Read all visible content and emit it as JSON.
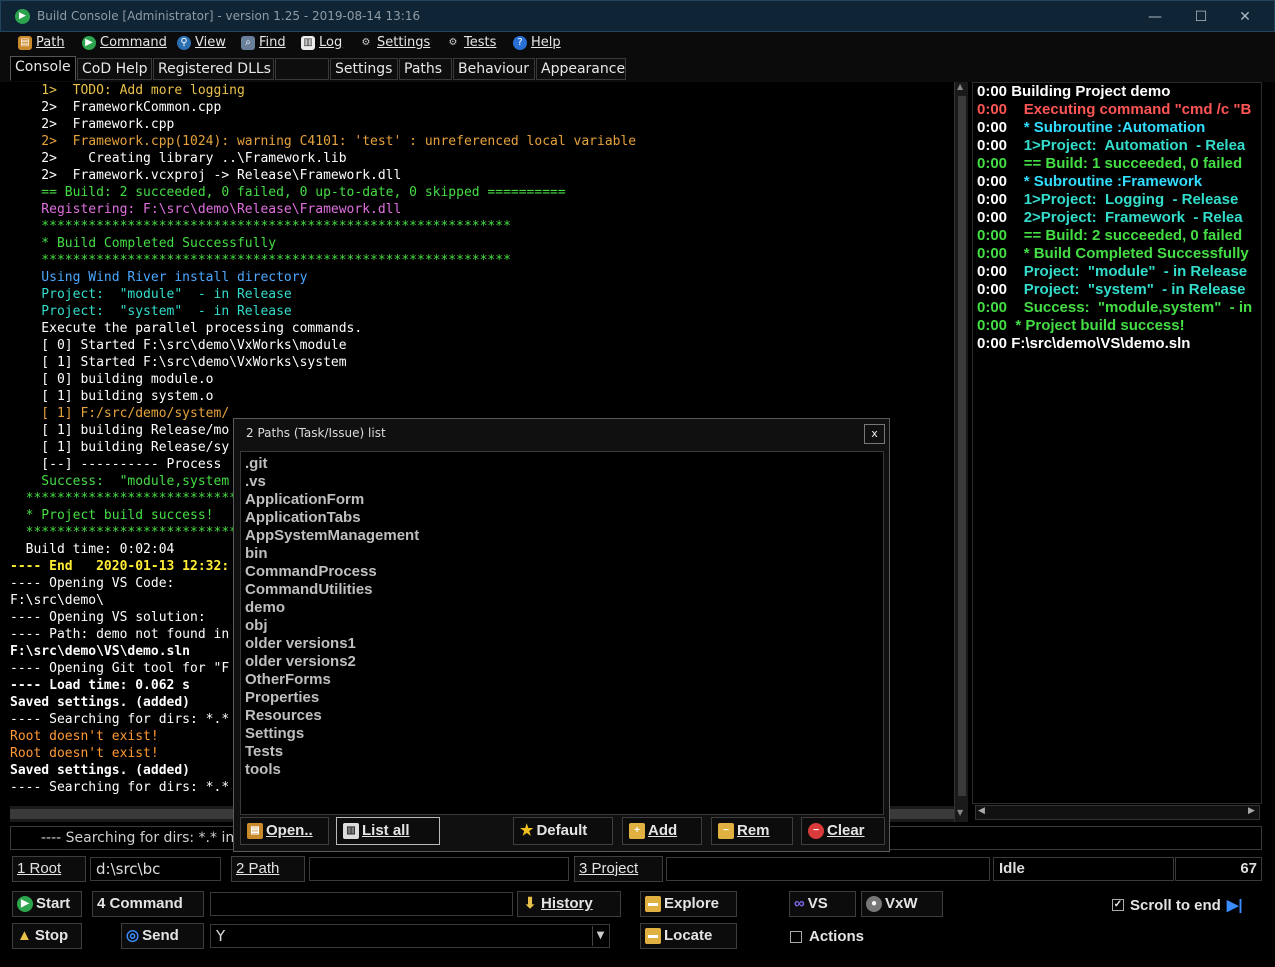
{
  "window": {
    "title": "Build Console [Administrator] - version 1.25 - 2019-08-14 13:16",
    "minimize": "—",
    "maximize": "☐",
    "close": "✕"
  },
  "menu": [
    "Path",
    "Command",
    "View",
    "Find",
    "Log",
    "Settings",
    "Tests",
    "Help"
  ],
  "tabs": [
    "Console",
    "CoD Help",
    "Registered DLLs",
    "",
    "Settings",
    "Paths",
    "Behaviour",
    "Appearance"
  ],
  "console_lines": [
    {
      "t": "    1>  TODO: Add more logging",
      "c": "#e8c14a"
    },
    {
      "t": "    2>  FrameworkCommon.cpp",
      "c": "#ffffff"
    },
    {
      "t": "    2>  Framework.cpp",
      "c": "#ffffff"
    },
    {
      "t": "    2>  Framework.cpp(1024): warning C4101: 'test' : unreferenced local variable",
      "c": "#e6a23c"
    },
    {
      "t": "    2>    Creating library ..\\Framework.lib",
      "c": "#ffffff"
    },
    {
      "t": "    2>  Framework.vcxproj -> Release\\Framework.dll",
      "c": "#ffffff"
    },
    {
      "t": "    == Build: 2 succeeded, 0 failed, 0 up-to-date, 0 skipped ==========",
      "c": "#44dd44"
    },
    {
      "t": "    Registering: F:\\src\\demo\\Release\\Framework.dll",
      "c": "#e070e0"
    },
    {
      "t": "    ************************************************************",
      "c": "#44dd44"
    },
    {
      "t": "    * Build Completed Successfully",
      "c": "#44dd44"
    },
    {
      "t": "    ************************************************************",
      "c": "#44dd44"
    },
    {
      "t": "    Using Wind River install directory",
      "c": "#4aa8ff"
    },
    {
      "t": "    Project:  \"module\"  - in Release",
      "c": "#33ddcc"
    },
    {
      "t": "    Project:  \"system\"  - in Release",
      "c": "#33ddcc"
    },
    {
      "t": "    Execute the parallel processing commands.",
      "c": "#ffffff"
    },
    {
      "t": "    [ 0] Started F:\\src\\demo\\VxWorks\\module",
      "c": "#ffffff"
    },
    {
      "t": "    [ 1] Started F:\\src\\demo\\VxWorks\\system",
      "c": "#ffffff"
    },
    {
      "t": "    [ 0] building module.o",
      "c": "#ffffff"
    },
    {
      "t": "    [ 1] building system.o",
      "c": "#ffffff"
    },
    {
      "t": "    [ 1] F:/src/demo/system/",
      "c": "#e6a23c"
    },
    {
      "t": "    [ 1] building Release/mo",
      "c": "#ffffff"
    },
    {
      "t": "    [ 1] building Release/sy",
      "c": "#ffffff"
    },
    {
      "t": "    [--] ---------- Process ",
      "c": "#ffffff"
    },
    {
      "t": "    Success:  \"module,system",
      "c": "#44dd44"
    },
    {
      "t": "  ******************************",
      "c": "#44dd44"
    },
    {
      "t": "  * Project build success!",
      "c": "#44dd44"
    },
    {
      "t": "  ******************************",
      "c": "#44dd44"
    },
    {
      "t": "  Build time: 0:02:04",
      "c": "#ffffff"
    },
    {
      "t": "---- End   2020-01-13 12:32:",
      "c": "#ffee33",
      "b": true
    },
    {
      "t": "---- Opening VS Code:",
      "c": "#ffffff"
    },
    {
      "t": "F:\\src\\demo\\",
      "c": "#ffffff"
    },
    {
      "t": "---- Opening VS solution:",
      "c": "#ffffff"
    },
    {
      "t": "---- Path: demo not found in",
      "c": "#ffffff"
    },
    {
      "t": "F:\\src\\demo\\VS\\demo.sln",
      "c": "#ffffff",
      "b": true
    },
    {
      "t": "---- Opening Git tool for \"F",
      "c": "#ffffff"
    },
    {
      "t": "---- Load time: 0.062 s",
      "c": "#ffffff",
      "b": true
    },
    {
      "t": "Saved settings. (added)",
      "c": "#ffffff",
      "b": true
    },
    {
      "t": "---- Searching for dirs: *.*",
      "c": "#ffffff"
    },
    {
      "t": "Root doesn't exist!",
      "c": "#ff9933"
    },
    {
      "t": "Root doesn't exist!",
      "c": "#ff9933"
    },
    {
      "t": "Saved settings. (added)",
      "c": "#ffffff",
      "b": true
    },
    {
      "t": "---- Searching for dirs: *.*",
      "c": "#ffffff"
    }
  ],
  "right_lines": [
    {
      "time": "0:00",
      "tc": "#ffffff",
      "t": " Building Project demo",
      "c": "#ffffff"
    },
    {
      "time": "0:00",
      "tc": "#ff5555",
      "t": "    Executing command \"cmd /c \"B",
      "c": "#ff5555"
    },
    {
      "time": "0:00",
      "tc": "#ffffff",
      "t": "    * Subroutine :Automation",
      "c": "#33ddff"
    },
    {
      "time": "0:00",
      "tc": "#ffffff",
      "t": "    1>Project:  Automation  - Relea",
      "c": "#33ddcc"
    },
    {
      "time": "0:00",
      "tc": "#44dd44",
      "t": "    == Build: 1 succeeded, 0 failed",
      "c": "#44dd44"
    },
    {
      "time": "0:00",
      "tc": "#ffffff",
      "t": "    * Subroutine :Framework",
      "c": "#33ddff"
    },
    {
      "time": "0:00",
      "tc": "#ffffff",
      "t": "    1>Project:  Logging  - Release",
      "c": "#33ddcc"
    },
    {
      "time": "0:00",
      "tc": "#ffffff",
      "t": "    2>Project:  Framework  - Relea",
      "c": "#33ddcc"
    },
    {
      "time": "0:00",
      "tc": "#44dd44",
      "t": "    == Build: 2 succeeded, 0 failed",
      "c": "#44dd44"
    },
    {
      "time": "0:00",
      "tc": "#44dd44",
      "t": "    * Build Completed Successfully",
      "c": "#44dd44"
    },
    {
      "time": "0:00",
      "tc": "#ffffff",
      "t": "    Project:  \"module\"  - in Release",
      "c": "#33ddcc"
    },
    {
      "time": "0:00",
      "tc": "#ffffff",
      "t": "    Project:  \"system\"  - in Release",
      "c": "#33ddcc"
    },
    {
      "time": "0:00",
      "tc": "#44dd44",
      "t": "    Success:  \"module,system\"  - in",
      "c": "#44dd44"
    },
    {
      "time": "0:00",
      "tc": "#44dd44",
      "t": "  * Project build success!",
      "c": "#44dd44"
    },
    {
      "time": "0:00",
      "tc": "#ffffff",
      "t": " F:\\src\\demo\\VS\\demo.sln",
      "c": "#ffffff"
    }
  ],
  "command_line": "---- Searching for dirs: *.* inside",
  "dialog": {
    "title": "2 Paths (Task/Issue) list",
    "close": "x",
    "items": [
      ".git",
      ".vs",
      "ApplicationForm",
      "ApplicationTabs",
      "AppSystemManagement",
      "bin",
      "CommandProcess",
      "CommandUtilities",
      "demo",
      "obj",
      "older versions1",
      "older versions2",
      "OtherForms",
      "Properties",
      "Resources",
      "Settings",
      "Tests",
      "tools"
    ],
    "buttons": {
      "open": "Open..",
      "list_all": "List all",
      "default": "Default",
      "add": "Add",
      "rem": "Rem",
      "clear": "Clear"
    }
  },
  "paths_row": {
    "root_label": "1 Root",
    "root_value": "d:\\src\\bc",
    "path_label": "2 Path",
    "path_value": "",
    "project_label": "3 Project",
    "project_value": "",
    "status": "Idle",
    "count": "67"
  },
  "buttons": {
    "start": "Start",
    "command": "4 Command",
    "history": "History",
    "explore": "Explore",
    "vs": "VS",
    "vxw": "VxW",
    "scroll_to_end": "Scroll to end",
    "stop": "Stop",
    "send": "Send",
    "locate": "Locate",
    "actions": "Actions"
  },
  "inputs": {
    "command_value": "",
    "send_value": "Y"
  }
}
